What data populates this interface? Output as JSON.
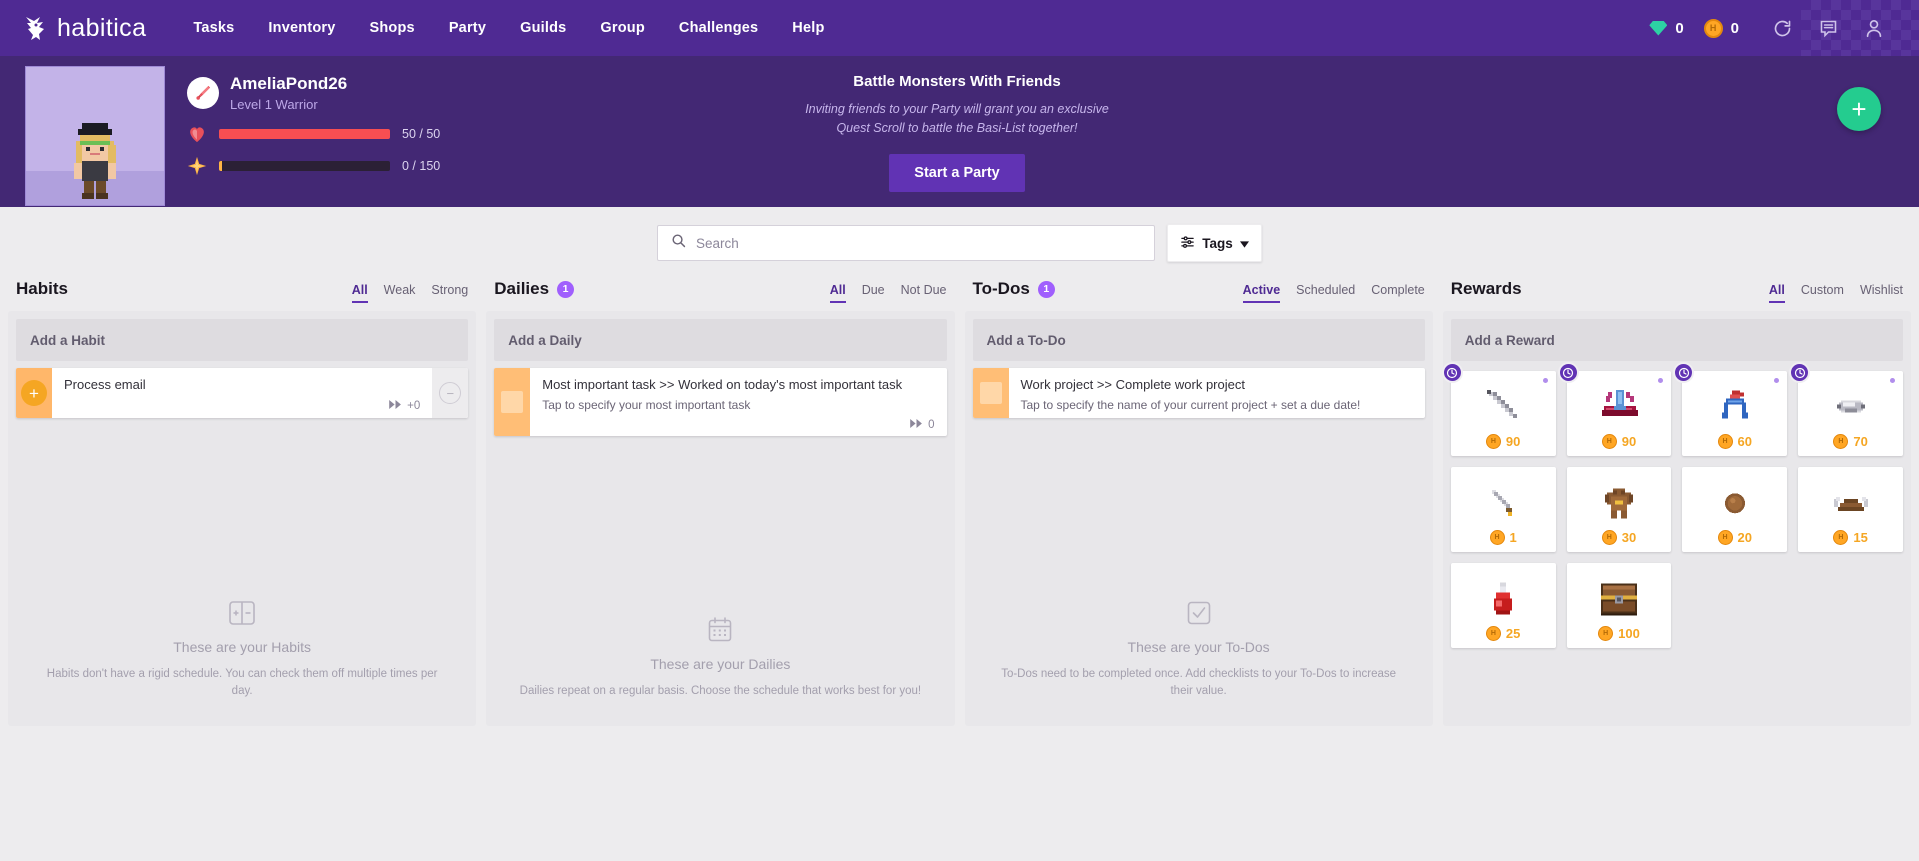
{
  "nav": {
    "brand": "habitica",
    "links": [
      "Tasks",
      "Inventory",
      "Shops",
      "Party",
      "Guilds",
      "Group",
      "Challenges",
      "Help"
    ],
    "gems": "0",
    "gold": "0",
    "icons": {
      "sync": "sync-icon",
      "messages": "messages-icon",
      "user": "user-avatar-icon"
    }
  },
  "profile": {
    "username": "AmeliaPond26",
    "level_class": "Level 1 Warrior",
    "health": {
      "label": "50 / 50",
      "percent": 100
    },
    "experience": {
      "label": "0 / 150",
      "percent": 2
    }
  },
  "promo": {
    "title": "Battle Monsters With Friends",
    "line1": "Inviting friends to your Party will grant you an exclusive",
    "line2": "Quest Scroll to battle the Basi-List together!",
    "button": "Start a Party"
  },
  "fab": {
    "label": "+"
  },
  "search": {
    "placeholder": "Search",
    "value": "",
    "tags_label": "Tags"
  },
  "columns": [
    {
      "key": "habits",
      "title": "Habits",
      "count": "",
      "filters": [
        "All",
        "Weak",
        "Strong"
      ],
      "active_filter": "All",
      "add_label": "Add a Habit",
      "tasks": [
        {
          "title": "Process email",
          "notes": "",
          "streak": "+0",
          "control": "habit-plus",
          "has_minus": true
        }
      ],
      "empty_title": "These are your Habits",
      "empty_text": "Habits don't have a rigid schedule. You can check them off multiple times per day.",
      "empty_icon": "habit-plus-minus-icon"
    },
    {
      "key": "dailies",
      "title": "Dailies",
      "count": "1",
      "filters": [
        "All",
        "Due",
        "Not Due"
      ],
      "active_filter": "All",
      "add_label": "Add a Daily",
      "tasks": [
        {
          "title": "Most important task >> Worked on today's most important task",
          "notes": "Tap to specify your most important task",
          "streak": "0",
          "control": "daily-checkbox",
          "has_minus": false
        }
      ],
      "empty_title": "These are your Dailies",
      "empty_text": "Dailies repeat on a regular basis. Choose the schedule that works best for you!",
      "empty_icon": "calendar-icon"
    },
    {
      "key": "todos",
      "title": "To-Dos",
      "count": "1",
      "filters": [
        "Active",
        "Scheduled",
        "Complete"
      ],
      "active_filter": "Active",
      "add_label": "Add a To-Do",
      "tasks": [
        {
          "title": "Work project >> Complete work project",
          "notes": "Tap to specify the name of your current project + set a due date!",
          "streak": "",
          "control": "todo-checkbox",
          "has_minus": false
        }
      ],
      "empty_title": "These are your To-Dos",
      "empty_text": "To-Dos need to be completed once. Add checklists to your To-Dos to increase their value.",
      "empty_icon": "checkbox-icon"
    }
  ],
  "rewards": {
    "title": "Rewards",
    "filters": [
      "All",
      "Custom",
      "Wishlist"
    ],
    "active_filter": "All",
    "add_label": "Add a Reward",
    "items": [
      {
        "name": "sword",
        "price": "90",
        "locked": true,
        "dot": true,
        "art": "sword-gray"
      },
      {
        "name": "armor",
        "price": "90",
        "locked": true,
        "dot": true,
        "art": "armor-red"
      },
      {
        "name": "helm",
        "price": "60",
        "locked": true,
        "dot": true,
        "art": "helm-blue"
      },
      {
        "name": "shield",
        "price": "70",
        "locked": true,
        "dot": true,
        "art": "shield-gray"
      },
      {
        "name": "training-sword",
        "price": "1",
        "locked": false,
        "dot": false,
        "art": "sword-basic"
      },
      {
        "name": "leather-armor",
        "price": "30",
        "locked": false,
        "dot": false,
        "art": "armor-brown"
      },
      {
        "name": "wooden-shield",
        "price": "20",
        "locked": false,
        "dot": false,
        "art": "shield-wood"
      },
      {
        "name": "leather-helm",
        "price": "15",
        "locked": false,
        "dot": false,
        "art": "helm-brown"
      },
      {
        "name": "health-potion",
        "price": "25",
        "locked": false,
        "dot": false,
        "art": "potion-red"
      },
      {
        "name": "treasure-chest",
        "price": "100",
        "locked": false,
        "dot": false,
        "art": "chest"
      }
    ]
  }
}
